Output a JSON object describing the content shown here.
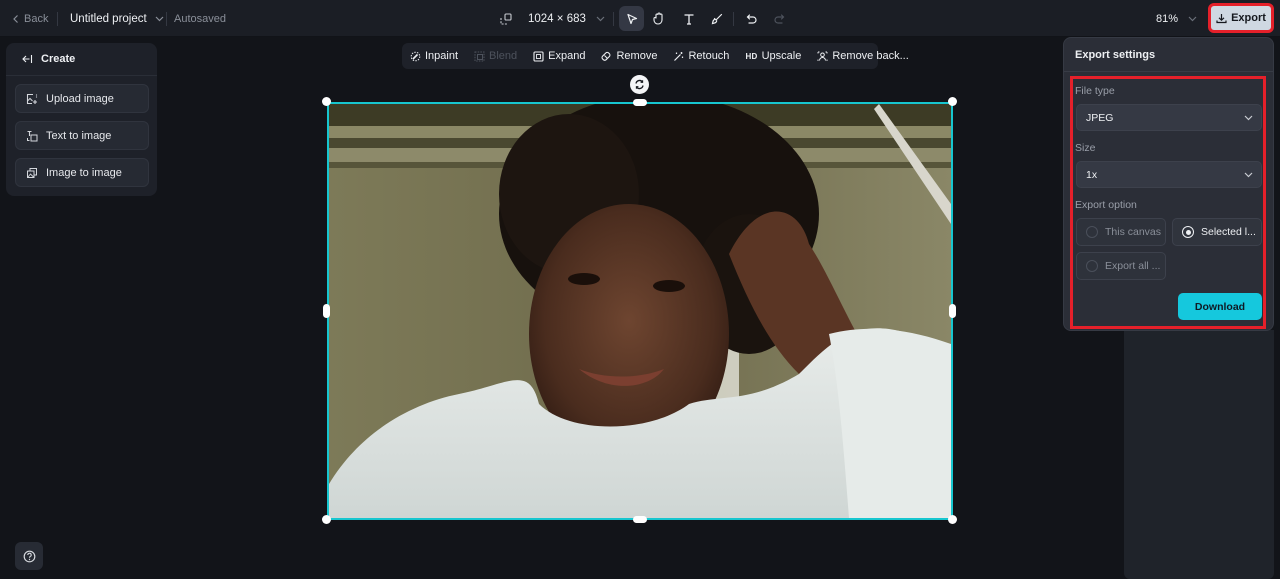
{
  "topbar": {
    "back_label": "Back",
    "project_name": "Untitled project",
    "save_status": "Autosaved",
    "canvas_size": "1024 × 683",
    "zoom_level": "81%",
    "export_label": "Export",
    "tools": [
      "resize-icon",
      "select-icon",
      "hand-icon",
      "text-icon",
      "brush-icon",
      "undo-icon",
      "redo-icon"
    ]
  },
  "left_panel": {
    "title": "Create",
    "items": [
      {
        "label": "Upload image",
        "icon": "upload-image-icon"
      },
      {
        "label": "Text to image",
        "icon": "text-to-image-icon"
      },
      {
        "label": "Image to image",
        "icon": "image-to-image-icon"
      }
    ]
  },
  "edit_toolbar": {
    "items": [
      {
        "label": "Inpaint",
        "icon": "inpaint-icon",
        "enabled": true
      },
      {
        "label": "Blend",
        "icon": "blend-icon",
        "enabled": false
      },
      {
        "label": "Expand",
        "icon": "expand-icon",
        "enabled": true
      },
      {
        "label": "Remove",
        "icon": "eraser-icon",
        "enabled": true
      },
      {
        "label": "Retouch",
        "icon": "magic-wand-icon",
        "enabled": true
      },
      {
        "label": "Upscale",
        "icon": "hd-icon",
        "icon_text": "HD",
        "enabled": true
      },
      {
        "label": "Remove back...",
        "icon": "remove-background-icon",
        "enabled": true
      }
    ]
  },
  "export_panel": {
    "title": "Export settings",
    "file_type_label": "File type",
    "file_type_value": "JPEG",
    "size_label": "Size",
    "size_value": "1x",
    "export_option_label": "Export option",
    "options": [
      {
        "label": "This canvas",
        "selected": false
      },
      {
        "label": "Selected l...",
        "selected": true
      },
      {
        "label": "Export all ...",
        "selected": false
      }
    ],
    "download_label": "Download"
  },
  "colors": {
    "accent": "#15c8dd",
    "selection": "#17c6cf",
    "highlight": "#e5202a",
    "background": "#121419"
  }
}
